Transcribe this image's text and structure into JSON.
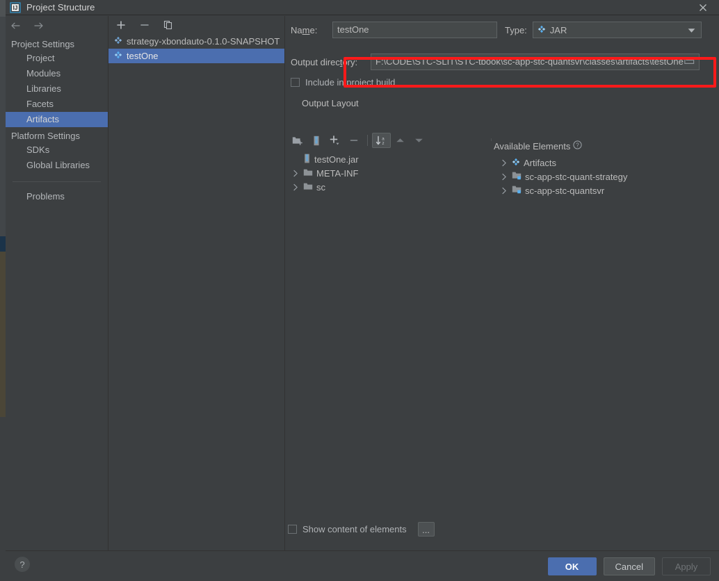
{
  "window": {
    "title": "Project Structure",
    "app_icon": "intellij-idea-icon",
    "close_icon": "close-icon"
  },
  "nav": {
    "back_icon": "arrow-left-icon",
    "forward_icon": "arrow-right-icon"
  },
  "sidebar": {
    "groups": [
      {
        "label": "Project Settings",
        "items": [
          {
            "label": "Project",
            "selected": false
          },
          {
            "label": "Modules",
            "selected": false
          },
          {
            "label": "Libraries",
            "selected": false
          },
          {
            "label": "Facets",
            "selected": false
          },
          {
            "label": "Artifacts",
            "selected": true
          }
        ]
      },
      {
        "label": "Platform Settings",
        "items": [
          {
            "label": "SDKs",
            "selected": false
          },
          {
            "label": "Global Libraries",
            "selected": false
          }
        ]
      }
    ],
    "problems_label": "Problems"
  },
  "artifact_list": {
    "toolbar": [
      {
        "name": "add-artifact-button",
        "icon": "plus-icon",
        "glyph": "+"
      },
      {
        "name": "remove-artifact-button",
        "icon": "minus-icon",
        "glyph": "−"
      },
      {
        "name": "copy-artifact-button",
        "icon": "copy-icon",
        "glyph": ""
      }
    ],
    "items": [
      {
        "label": "strategy-xbondauto-0.1.0-SNAPSHOT",
        "icon": "artifact-icon",
        "selected": false
      },
      {
        "label": "testOne",
        "icon": "artifact-icon",
        "selected": true
      }
    ]
  },
  "editor": {
    "name_label": "Name:",
    "name_label_pre": "Na",
    "name_label_accel": "m",
    "name_label_post": "e:",
    "name_value": "testOne",
    "type_label": "Type:",
    "type_value": "JAR",
    "type_icon": "artifact-icon",
    "output_dir_label": "Output directory:",
    "output_dir_label_pre": "Output direc",
    "output_dir_label_accel": "t",
    "output_dir_label_post": "ory:",
    "output_dir_value": "F:\\CODE\\STC-SLIT\\STC-tbook\\sc-app-stc-quantsvr\\classes\\artifacts\\testOne",
    "browse_icon": "folder-browse-icon",
    "include_in_build_label": "Include in project build",
    "include_in_build_pre": "Include in project ",
    "include_in_build_accel": "b",
    "include_in_build_post": "uild",
    "include_in_build_checked": false,
    "output_layout_label": "Output Layout",
    "layout_toolbar": [
      {
        "name": "add-directory-button",
        "icon": "new-folder-icon"
      },
      {
        "name": "add-archive-button",
        "icon": "archive-icon"
      },
      {
        "name": "add-element-button",
        "icon": "plus-dropdown-icon"
      },
      {
        "name": "remove-element-button",
        "icon": "minus-icon"
      },
      {
        "name": "sort-elements-button",
        "icon": "sort-az-icon",
        "active": true
      },
      {
        "name": "move-up-button",
        "icon": "arrow-up-icon"
      },
      {
        "name": "move-down-button",
        "icon": "arrow-down-icon"
      }
    ],
    "output_tree": [
      {
        "label": "testOne.jar",
        "icon": "archive-icon",
        "expandable": false,
        "indent": 0
      },
      {
        "label": "META-INF",
        "icon": "folder-icon",
        "expandable": true,
        "indent": 0
      },
      {
        "label": "sc",
        "icon": "folder-icon",
        "expandable": true,
        "indent": 0
      }
    ],
    "available_elements_label": "Available Elements",
    "available_elements_help_icon": "help-circle-icon",
    "available_tree": [
      {
        "label": "Artifacts",
        "icon": "artifact-icon",
        "expandable": true
      },
      {
        "label": "sc-app-stc-quant-strategy",
        "icon": "module-icon",
        "expandable": true
      },
      {
        "label": "sc-app-stc-quantsvr",
        "icon": "module-icon",
        "expandable": true
      }
    ],
    "show_content_label": "Show content of elements",
    "show_content_checked": false,
    "dots_button_label": "..."
  },
  "footer": {
    "help_label": "?",
    "help_icon": "help-icon",
    "ok_label": "OK",
    "cancel_label": "Cancel",
    "apply_label": "Apply",
    "apply_disabled": true
  },
  "annotation": {
    "highlight_color": "#ff1a1a",
    "target": "output-directory-field"
  },
  "colors": {
    "window_background": "#3c3f41",
    "selection_blue": "#4b6eaf",
    "input_background": "#45494a",
    "text_primary": "#bbbbbb",
    "icon_blue": "#3592c4"
  }
}
